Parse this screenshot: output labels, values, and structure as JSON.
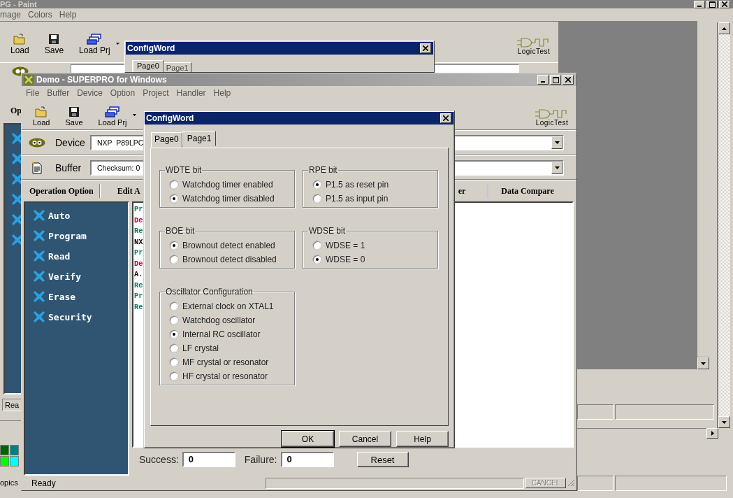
{
  "paint_window": {
    "title": "PG - Paint",
    "menu": [
      "mage",
      "Colors",
      "Help"
    ],
    "palette": [
      {
        "color": "#006400"
      },
      {
        "color": "#008080"
      },
      {
        "color": "#00ff00"
      },
      {
        "color": "#00ffff"
      }
    ],
    "status": "opics"
  },
  "back_window": {
    "toolbar": [
      {
        "kind": "open",
        "label": "Load"
      },
      {
        "kind": "save",
        "label": "Save"
      },
      {
        "kind": "project",
        "label": "Load Prj"
      }
    ],
    "logo": "LogicTest",
    "panel_label": "Op",
    "status": "Rea"
  },
  "back_dialog": {
    "title": "ConfigWord",
    "tabs": [
      {
        "label": "Page0",
        "selected": true
      },
      {
        "label": "Page1",
        "selected": false
      }
    ]
  },
  "main_window": {
    "title": "Demo - SUPERPRO for Windows",
    "menu": [
      "File",
      "Buffer",
      "Device",
      "Option",
      "Project",
      "Handler",
      "Help"
    ],
    "toolbar": [
      {
        "kind": "open",
        "label": "Load"
      },
      {
        "kind": "save",
        "label": "Save"
      },
      {
        "kind": "project",
        "label": "Load Prj"
      }
    ],
    "logo": "LogicTest",
    "device": {
      "label": "Device",
      "value": "NXP  P89LPC"
    },
    "buffer": {
      "label": "Buffer",
      "value": "Checksum: 0"
    },
    "columns": [
      "Operation Option",
      "Edit A",
      "er",
      "Data Compare"
    ],
    "operations": [
      "Auto",
      "Program",
      "Read",
      "Verify",
      "Erase",
      "Security"
    ],
    "log": [
      {
        "text": "Pr",
        "color": "#00806a"
      },
      {
        "text": "De",
        "color": "#c0003a"
      },
      {
        "text": "Re",
        "color": "#00806a"
      },
      {
        "text": "NX",
        "color": "#000000"
      },
      {
        "text": "Pr",
        "color": "#00806a"
      },
      {
        "text": "De",
        "color": "#c0003a"
      },
      {
        "text": "A.",
        "color": "#000000"
      },
      {
        "text": "Re",
        "color": "#00806a"
      },
      {
        "text": "Pr",
        "color": "#00806a"
      },
      {
        "text": "Re",
        "color": "#00806a"
      }
    ],
    "success": {
      "label": "Success:",
      "value": "0"
    },
    "failure": {
      "label": "Failure:",
      "value": "0"
    },
    "reset": "Reset",
    "status": "Ready",
    "cancel": {
      "label": "CANCEL",
      "disabled": true
    }
  },
  "config_dialog": {
    "title": "ConfigWord",
    "tabs": [
      {
        "label": "Page0",
        "selected": false
      },
      {
        "label": "Page1",
        "selected": true
      }
    ],
    "groups": [
      {
        "title": "WDTE bit",
        "options": [
          {
            "label": "Watchdog timer enabled",
            "selected": false
          },
          {
            "label": "Watchdog timer disabled",
            "selected": true
          }
        ]
      },
      {
        "title": "RPE bit",
        "options": [
          {
            "label": "P1.5 as reset pin",
            "selected": true
          },
          {
            "label": "P1.5 as input pin",
            "selected": false
          }
        ]
      },
      {
        "title": "BOE bit",
        "options": [
          {
            "label": "Brownout detect enabled",
            "selected": true
          },
          {
            "label": "Brownout detect disabled",
            "selected": false
          }
        ]
      },
      {
        "title": "WDSE bit",
        "options": [
          {
            "label": "WDSE = 1",
            "selected": false
          },
          {
            "label": "WDSE = 0",
            "selected": true
          }
        ]
      },
      {
        "title": "Oscillator Configuration",
        "options": [
          {
            "label": "External clock on XTAL1",
            "selected": false
          },
          {
            "label": "Watchdog oscillator",
            "selected": false
          },
          {
            "label": "Internal RC oscillator",
            "selected": true
          },
          {
            "label": "LF crystal",
            "selected": false
          },
          {
            "label": "MF crystal or resonator",
            "selected": false
          },
          {
            "label": "HF crystal or resonator",
            "selected": false
          }
        ]
      }
    ],
    "buttons": [
      "OK",
      "Cancel",
      "Help"
    ]
  }
}
